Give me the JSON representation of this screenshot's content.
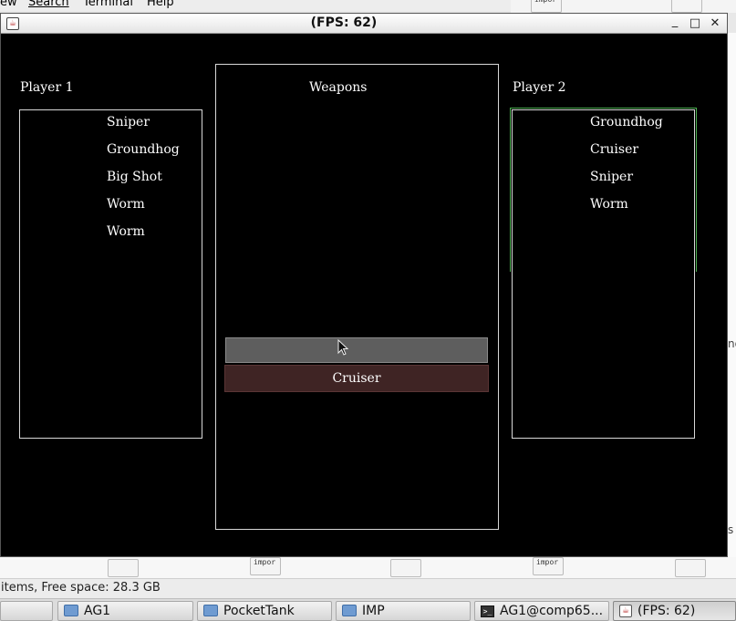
{
  "background": {
    "menu": [
      "ew",
      "Search",
      "Terminal",
      "Help"
    ],
    "file_icon_text": "impor",
    "side_text_1": "ng",
    "side_text_2": "s",
    "status_text": "items, Free space: 28.3 GB"
  },
  "window": {
    "title": "(FPS: 62)",
    "minimize": "_",
    "maximize": "□",
    "close": "✕"
  },
  "game": {
    "player1": {
      "label": "Player 1",
      "weapons": [
        "Sniper",
        "Groundhog",
        "Big Shot",
        "Worm",
        "Worm"
      ]
    },
    "center": {
      "label": "Weapons",
      "selected_weapon": "Cruiser"
    },
    "player2": {
      "label": "Player 2",
      "weapons": [
        "Groundhog",
        "Cruiser",
        "Sniper",
        "Worm"
      ]
    }
  },
  "taskbar": {
    "items": [
      "",
      "AG1",
      "PocketTank",
      "IMP",
      "AG1@comp65...",
      "(FPS: 62)"
    ]
  },
  "colors": {
    "game_bg": "#000000",
    "selected_bar": "#3f2424",
    "gray_bar": "#5e5e5e",
    "player2_highlight": "#4caf50"
  }
}
